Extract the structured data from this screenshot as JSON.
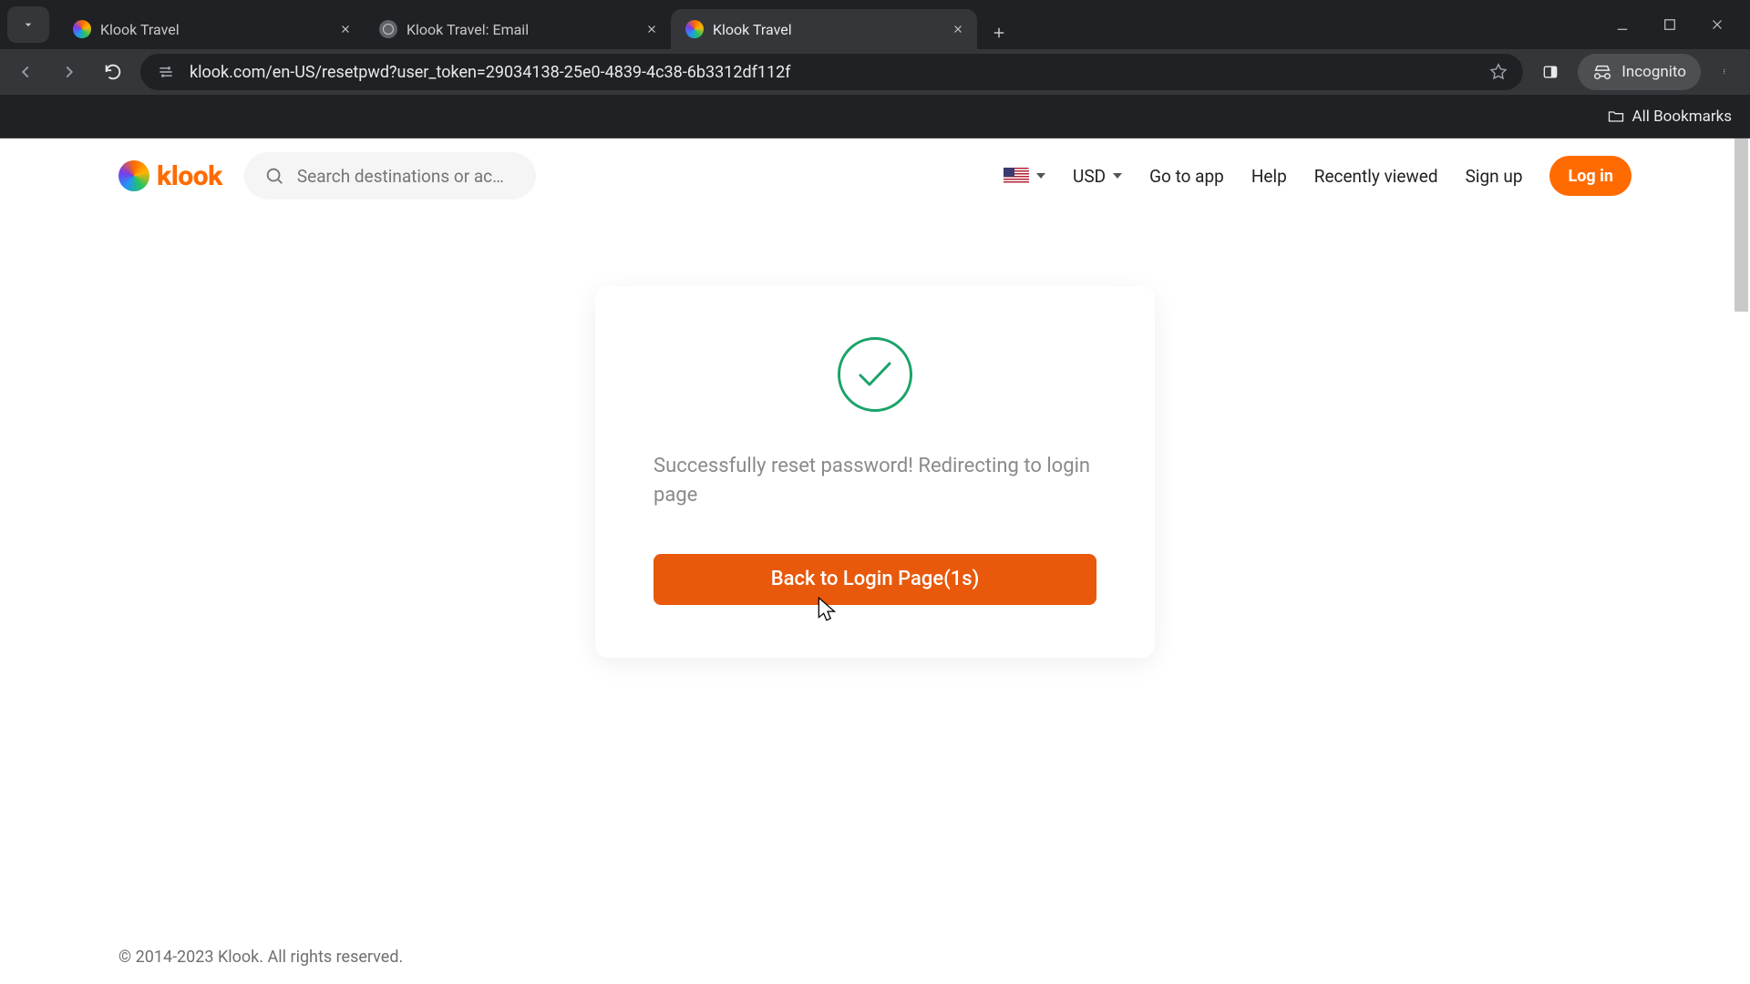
{
  "browser": {
    "tabs": [
      {
        "title": "Klook Travel",
        "active": false,
        "favicon": "klook"
      },
      {
        "title": "Klook Travel: Email",
        "active": false,
        "favicon": "globe"
      },
      {
        "title": "Klook Travel",
        "active": true,
        "favicon": "klook"
      }
    ],
    "url_display": "klook.com/en-US/resetpwd?user_token=29034138-25e0-4839-4c38-6b3312df112f",
    "incognito_label": "Incognito",
    "bookmarks_label": "All Bookmarks"
  },
  "header": {
    "logo_text": "klook",
    "search_placeholder": "Search destinations or ac…",
    "currency": "USD",
    "go_to_app": "Go to app",
    "help": "Help",
    "recently_viewed": "Recently viewed",
    "sign_up": "Sign up",
    "log_in": "Log in"
  },
  "card": {
    "message": "Successfully reset password! Redirecting to login page",
    "cta": "Back to Login Page(1s)"
  },
  "footer": {
    "copyright": "© 2014-2023 Klook. All rights reserved."
  }
}
